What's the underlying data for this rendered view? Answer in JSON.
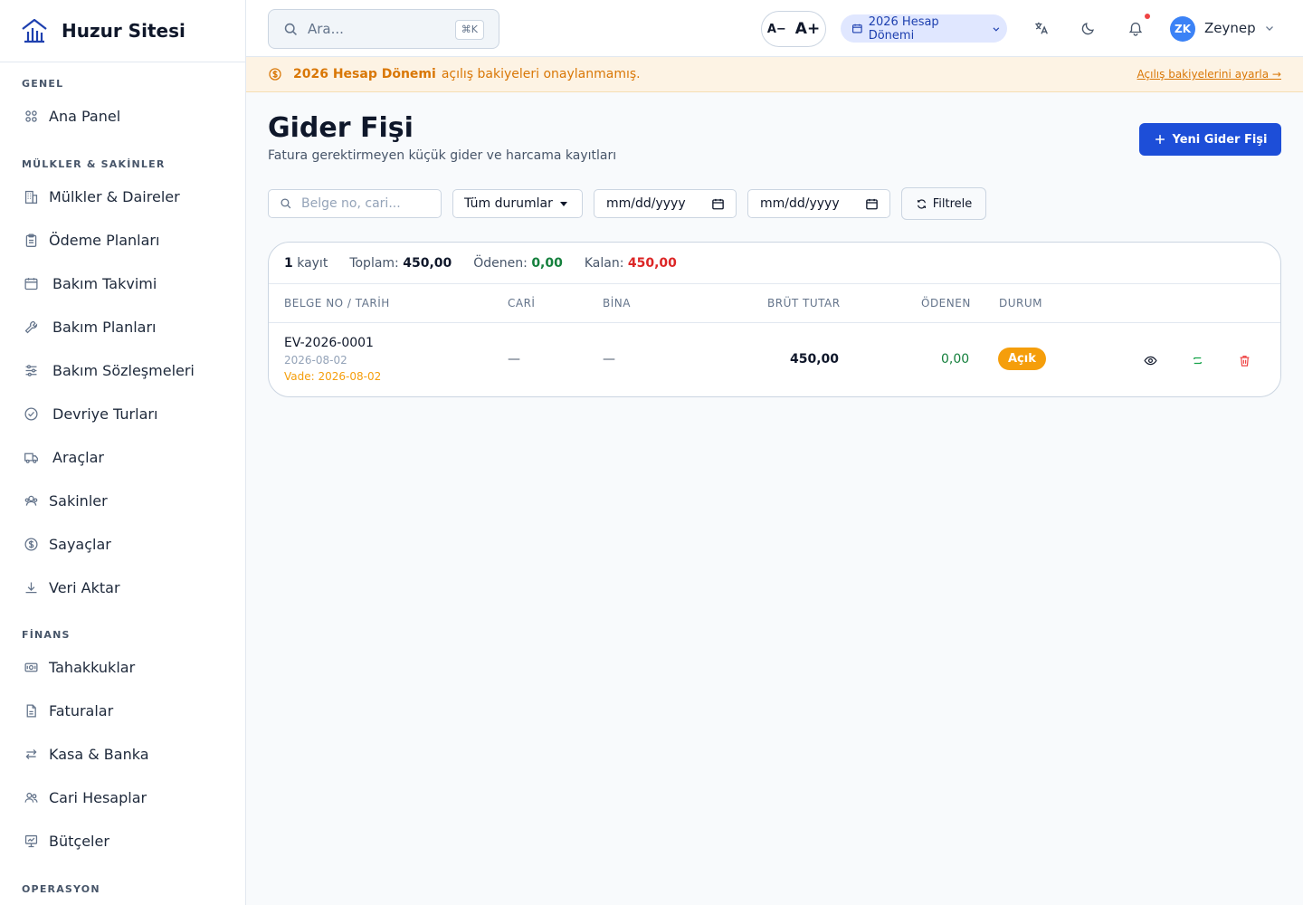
{
  "brand": {
    "name": "Huzur Sitesi"
  },
  "sidebar": {
    "sections": [
      {
        "label": "GENEL"
      },
      {
        "label": "MÜLKLER & SAKİNLER"
      },
      {
        "label": "FİNANS"
      },
      {
        "label": "OPERASYON"
      }
    ],
    "items": [
      {
        "label": "Ana Panel",
        "icon": "grid-icon"
      },
      {
        "label": "Mülkler & Daireler",
        "icon": "building-icon"
      },
      {
        "label": "Ödeme Planları",
        "icon": "clipboard-icon"
      },
      {
        "label": "Bakım Takvimi",
        "icon": "calendar-icon"
      },
      {
        "label": "Bakım Planları",
        "icon": "wrench-icon"
      },
      {
        "label": "Bakım Sözleşmeleri",
        "icon": "sliders-icon"
      },
      {
        "label": "Devriye Turları",
        "icon": "check-circle-icon"
      },
      {
        "label": "Araçlar",
        "icon": "truck-icon"
      },
      {
        "label": "Sakinler",
        "icon": "users-icon"
      },
      {
        "label": "Sayaçlar",
        "icon": "dollar-circle-icon"
      },
      {
        "label": "Veri Aktar",
        "icon": "download-icon"
      },
      {
        "label": "Tahakkuklar",
        "icon": "banknote-icon"
      },
      {
        "label": "Faturalar",
        "icon": "file-icon"
      },
      {
        "label": "Kasa & Banka",
        "icon": "arrows-icon"
      },
      {
        "label": "Cari Hesaplar",
        "icon": "people-icon"
      },
      {
        "label": "Bütçeler",
        "icon": "presentation-icon"
      }
    ]
  },
  "topbar": {
    "search_placeholder": "Ara...",
    "search_shortcut": "⌘K",
    "font_smaller": "A−",
    "font_larger": "A+",
    "period": "2026 Hesap Dönemi",
    "user": {
      "initials": "ZK",
      "name": "Zeynep"
    }
  },
  "banner": {
    "bold": "2026 Hesap Dönemi",
    "text": "açılış bakiyeleri onaylanmamış.",
    "link": "Açılış bakiyelerini ayarla →"
  },
  "page": {
    "title": "Gider Fişi",
    "subtitle": "Fatura gerektirmeyen küçük gider ve harcama kayıtları",
    "new_button": "Yeni Gider Fişi"
  },
  "filters": {
    "search_placeholder": "Belge no, cari...",
    "status": "Tüm durumlar",
    "date_from": "mm/dd/yyyy",
    "date_to": "mm/dd/yyyy",
    "filter_button": "Filtrele"
  },
  "summary": {
    "count": "1",
    "count_label": "kayıt",
    "total_label": "Toplam:",
    "total": "450,00",
    "paid_label": "Ödenen:",
    "paid": "0,00",
    "remaining_label": "Kalan:",
    "remaining": "450,00"
  },
  "table": {
    "headers": [
      "BELGE NO / TARİH",
      "CARİ",
      "BİNA",
      "BRÜT TUTAR",
      "ÖDENEN",
      "DURUM"
    ],
    "rows": [
      {
        "doc_no": "EV-2026-0001",
        "date": "2026-08-02",
        "due": "Vade: 2026-08-02",
        "cari": "—",
        "bina": "—",
        "gross": "450,00",
        "paid": "0,00",
        "status": "Açık"
      }
    ]
  },
  "colors": {
    "primary": "#1d4ed8",
    "warning": "#d97706",
    "status_open": "#f59e0b",
    "success": "#15803d",
    "danger": "#dc2626"
  }
}
